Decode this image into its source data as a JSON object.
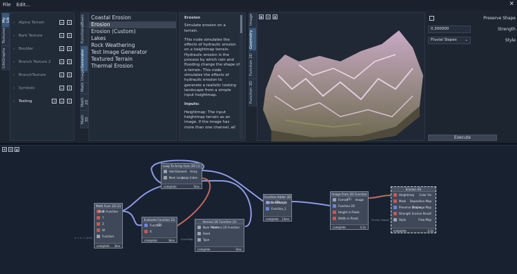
{
  "menu": {
    "file": "File",
    "edit": "Edit..."
  },
  "lib_tabs": [
    "My Lib",
    "Textures",
    "LifeGraphs"
  ],
  "library": [
    {
      "name": "Alpine Terrain",
      "bright": false
    },
    {
      "name": "Bark Texture",
      "bright": false
    },
    {
      "name": "Boulder",
      "bright": false
    },
    {
      "name": "Branch Texture 2",
      "bright": false
    },
    {
      "name": "BranchTexture",
      "bright": false
    },
    {
      "name": "Symbols",
      "bright": false
    },
    {
      "name": "Testing",
      "bright": true
    }
  ],
  "cat_tabs": [
    "Basic",
    "Functional",
    "Generator",
    "Image",
    "Math",
    "Math 2D",
    "Math 3D"
  ],
  "categories": [
    "Coastal Erosion",
    "Erosion",
    "Erosion (Custom)",
    "Lakes",
    "Rock Weathering",
    "Test Image Generator",
    "Textured Terrain",
    "Thermal Erosion"
  ],
  "selected_category": "Erosion",
  "doc": {
    "title": "Erosion",
    "p1": "Simulate erosion on a terrain.",
    "p2": "This node simulates the effects of hydraulic erosion on a heightmap terrain. Hydraulic erosion is the process by which rain and flooding change the shape of a terrain. This node simulates the effects of hydraulic erosion to generate a realistic looking landscape from a simple input heightmap.",
    "inputs_h": "Inputs:",
    "p3": "Heightmap: The input heightmap terrain as an image. If the image has more than one channel, all"
  },
  "view_tabs": [
    "Image",
    "Geometry",
    "Function 2D",
    "Function 3D"
  ],
  "props": {
    "preserve_label": "Preserve Shape",
    "strength_value": "0,300000",
    "strength_label": "Strength",
    "style_value": "Fluvial Slopes",
    "style_label": "Style",
    "execute": "Execute"
  },
  "nodes": {
    "loop": {
      "title": "Loop To Array Func 2D (1)",
      "in1": "Add Element",
      "in2": "Num Loops",
      "out1": "Array",
      "out2": "Loop Index",
      "foot": "complete",
      "time": "5ms"
    },
    "mathf": {
      "title": "Math Func 1D (2)",
      "in1": "X",
      "in2": "Y",
      "in3": "Z",
      "in4": "W",
      "in5": "Function",
      "out1": "Math Function",
      "side": "x + 2 + (0.5)",
      "foot": "complete",
      "time": "3ms"
    },
    "eval": {
      "title": "Evaluate Function 1D (3)",
      "in1": "Function",
      "in2": "X",
      "foot": "complete",
      "time": "6ms"
    },
    "voronoi": {
      "title": "Voronoi 2D Function (2)",
      "in1": "Num Points",
      "in2": "Seed",
      "in3": "Type",
      "out1": "Voronoi 2D Function",
      "side": "EuclidSqr",
      "foot": "complete",
      "time": "5ms"
    },
    "adder": {
      "title": "Function Adder 2D (4)",
      "in1": "Function_0",
      "in2": "Function_1",
      "out1": "Adder Function",
      "foot": "complete",
      "time": "13ms"
    },
    "img2d": {
      "title": "Image From 2D Function (5)",
      "in1": "Format",
      "in2": "Function 2D",
      "in3": "Height in Pixels",
      "in4": "Width in Pixels",
      "out1": "Image",
      "foot": "complete",
      "time": "4.2s"
    },
    "erosion": {
      "title": "Erosion (6)",
      "in1": "Heightmap",
      "in2": "Mask",
      "in3": "Preserve Shape",
      "in4": "Strength",
      "in5": "Style",
      "out1": "Color Vis",
      "out2": "Deposition Map",
      "out3": "Drainage Map",
      "out4": "Erosion Result",
      "out5": "Flow Map",
      "side": "Fluvial Slopes",
      "foot": "complete",
      "time": "4.2s"
    }
  },
  "colors": {
    "bg": "#1b2330",
    "red_port": "#c95757",
    "blue_port": "#6d84d8",
    "wire_blue": "#8e9be6",
    "wire_red": "#c46a5f"
  }
}
